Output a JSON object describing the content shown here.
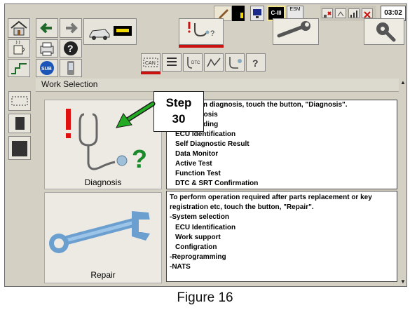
{
  "status": {
    "cm_label": "C-III",
    "esm_label": "ESM",
    "time": "03:02"
  },
  "toolbar": {
    "dtc_label": "DTC"
  },
  "left_panel": {
    "sub_label": "SUB",
    "can_label": "CAN"
  },
  "page": {
    "title": "Work Selection"
  },
  "diagnosis": {
    "button_label": "Diagnosis",
    "desc_first": "To perform diagnosis, touch the button, \"Diagnosis\".",
    "items": [
      "-All Diagnosis",
      "-Data Reading",
      "ECU Identification",
      "Self Diagnostic Result",
      "Data Monitor",
      "Active Test",
      "Function Test",
      "DTC & SRT Confirmation"
    ]
  },
  "repair": {
    "button_label": "Repair",
    "desc_lines": [
      "To perform operation required after parts replacement or key",
      "registration etc, touch the button, \"Repair\".",
      "-System selection"
    ],
    "sub_items": [
      "ECU Identification",
      "Work support",
      "Configration"
    ],
    "tail_items": [
      "-Reprogramming",
      "-NATS"
    ]
  },
  "callout": {
    "line1": "Step",
    "line2": "30"
  },
  "caption": "Figure 16",
  "colors": {
    "screen_bg": "#d4d0c4",
    "accent_red": "#cc1111",
    "arrow_green": "#22aa22"
  }
}
